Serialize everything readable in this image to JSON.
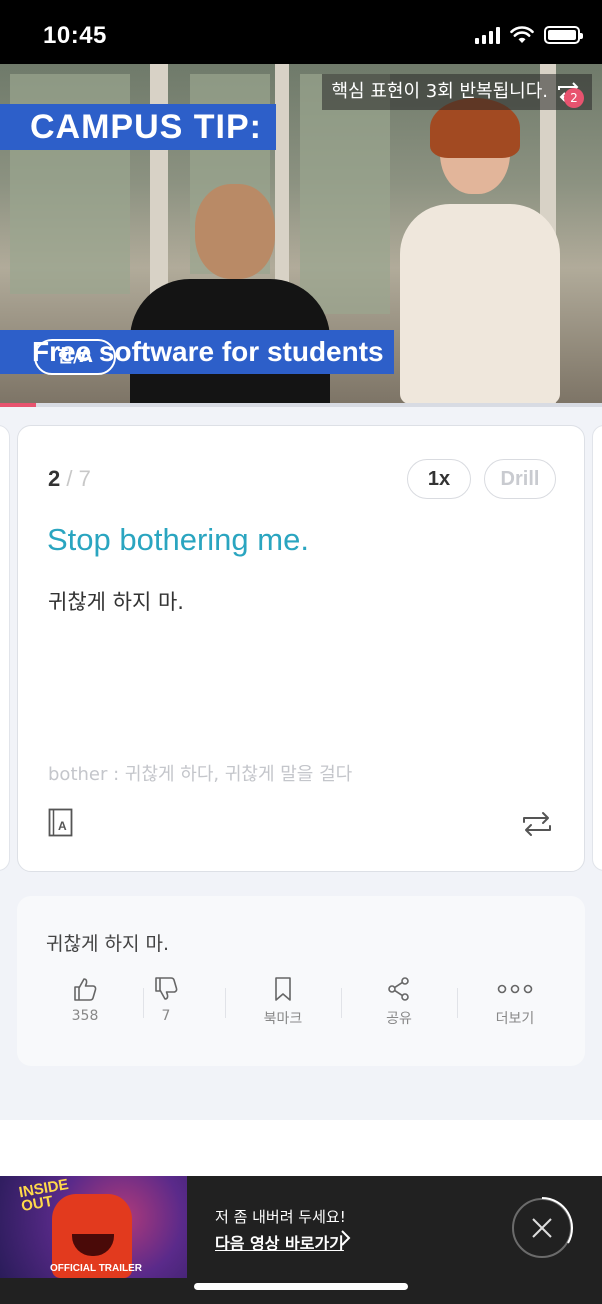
{
  "status_bar": {
    "time": "10:45"
  },
  "video": {
    "banner_top": "CAMPUS TIP:",
    "banner_bottom": "Free software for students",
    "repeat_tip": "핵심 표현이 3회 반복됩니다.",
    "repeat_badge": "2",
    "lang_toggle": "한/A",
    "progress_fraction": 0.06
  },
  "card": {
    "current": "2",
    "total": "/ 7",
    "speed_label": "1x",
    "drill_label": "Drill",
    "english": "Stop bothering me.",
    "korean": "귀찮게 하지 마.",
    "vocab": "bother : 귀찮게 하다, 귀찮게 말을 걸다"
  },
  "comment": {
    "text": "귀찮게 하지 마.",
    "like_count": "358",
    "dislike_count": "7",
    "bookmark_label": "북마크",
    "share_label": "공유",
    "more_label": "더보기"
  },
  "ad": {
    "line1": "저 좀 내버려 두세요!",
    "line2": "다음 영상 바로가기",
    "thumb_logo_line1": "INSIDE",
    "thumb_logo_line2": "OUT",
    "thumb_caption": "OFFICIAL TRAILER"
  },
  "colors": {
    "accent": "#2aa5c0",
    "progress": "#e8536f",
    "banner": "#2d5fc9"
  }
}
